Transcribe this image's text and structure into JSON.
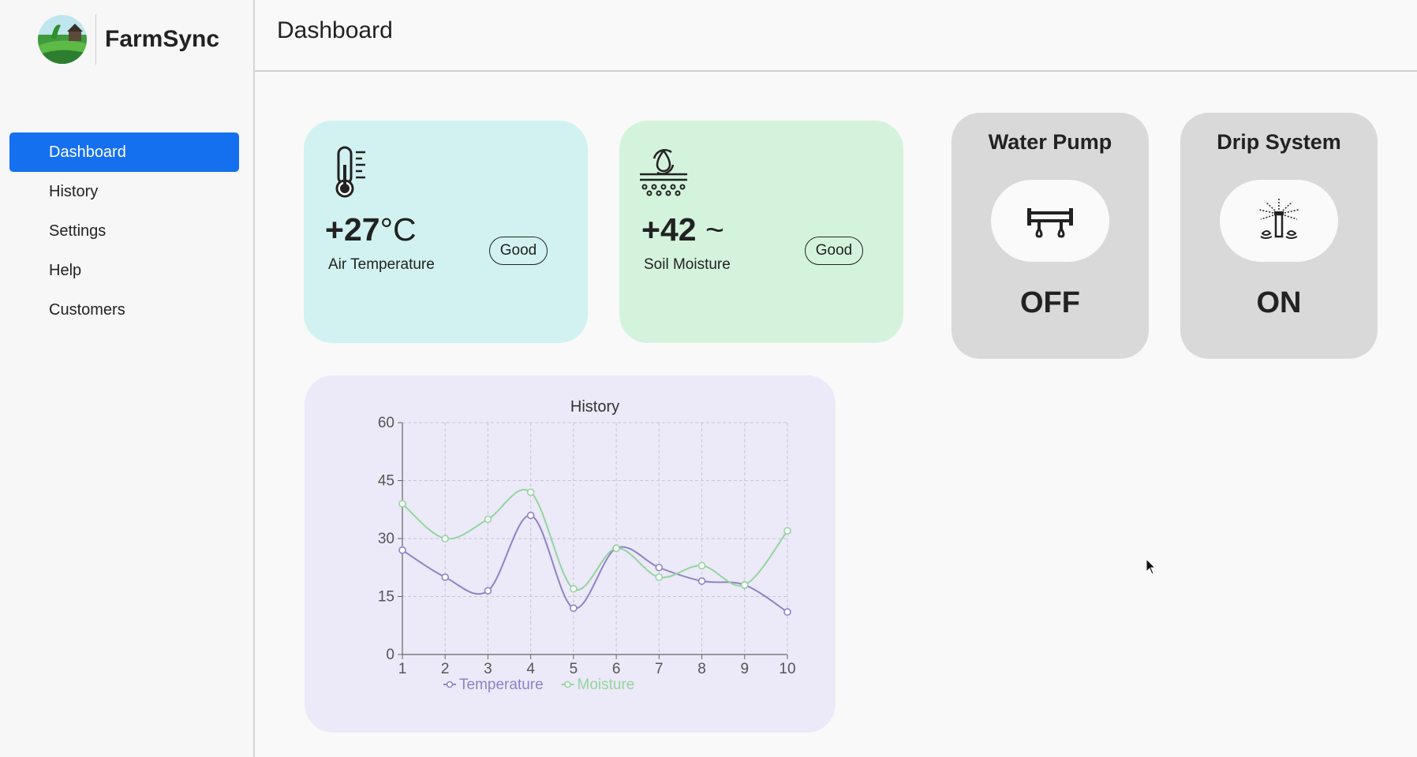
{
  "app": {
    "name": "FarmSync"
  },
  "sidebar": {
    "items": [
      {
        "label": "Dashboard",
        "active": true
      },
      {
        "label": "History"
      },
      {
        "label": "Settings"
      },
      {
        "label": "Help"
      },
      {
        "label": "Customers"
      }
    ]
  },
  "header": {
    "title": "Dashboard"
  },
  "cards": {
    "temperature": {
      "sign_value": "+27",
      "unit": "°C",
      "label": "Air Temperature",
      "status": "Good",
      "icon": "thermometer-icon",
      "color": "#d1f2f0"
    },
    "moisture": {
      "sign_value": "+42",
      "unit": "~",
      "label": "Soil Moisture",
      "status": "Good",
      "icon": "soil-moisture-icon",
      "color": "#d4f3dc"
    }
  },
  "controls": {
    "pump": {
      "title": "Water Pump",
      "state": "OFF",
      "icon": "pipe-valve-icon"
    },
    "drip": {
      "title": "Drip System",
      "state": "ON",
      "icon": "sprinkler-icon"
    }
  },
  "chart_data": {
    "type": "line",
    "title": "History",
    "x": [
      1,
      2,
      3,
      4,
      5,
      6,
      7,
      8,
      9,
      10
    ],
    "ylim": [
      0,
      60
    ],
    "yticks": [
      0,
      15,
      30,
      45,
      60
    ],
    "grid": true,
    "legend": "bottom",
    "series": [
      {
        "name": "Temperature",
        "color": "#8e83c7",
        "values": [
          27,
          20,
          16.5,
          36,
          12,
          27.5,
          22.5,
          19,
          18,
          11
        ]
      },
      {
        "name": "Moisture",
        "color": "#93d59e",
        "values": [
          39,
          30,
          35,
          42,
          17,
          27.5,
          20,
          23,
          18,
          32
        ]
      }
    ]
  }
}
